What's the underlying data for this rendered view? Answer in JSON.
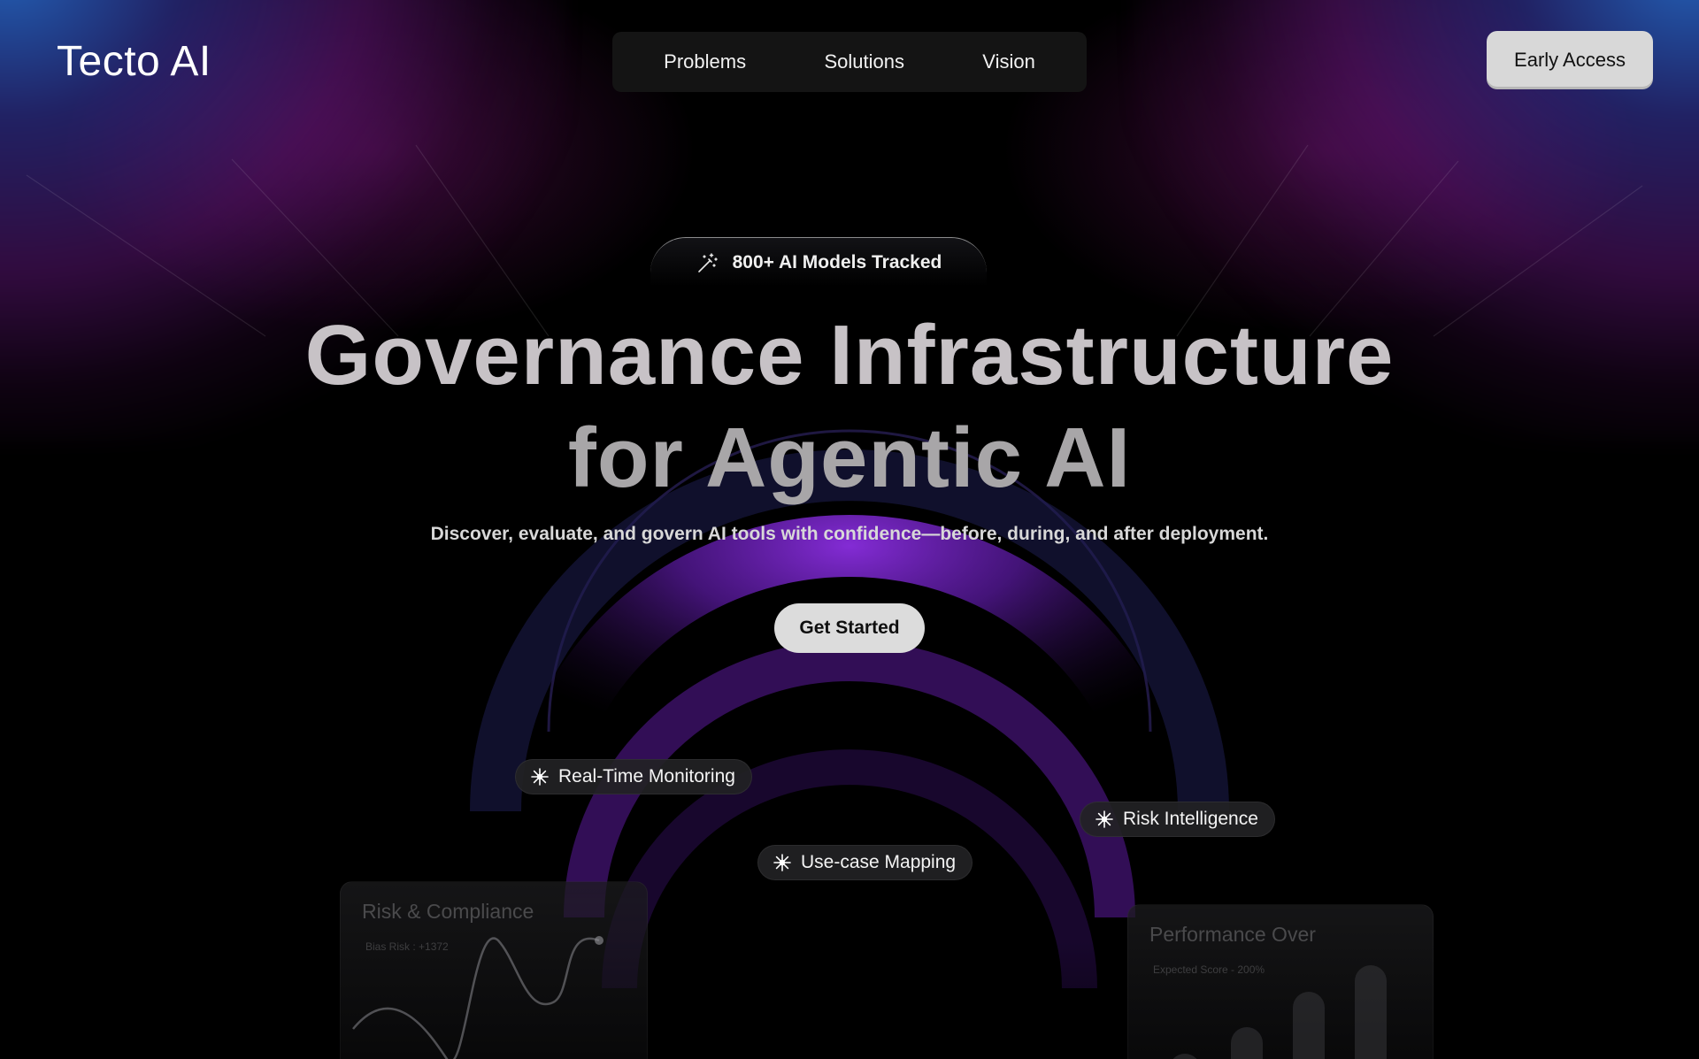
{
  "brand": {
    "logo_text": "Tecto AI"
  },
  "nav": {
    "items": [
      "Problems",
      "Solutions",
      "Vision"
    ]
  },
  "header": {
    "early_access_label": "Early Access"
  },
  "hero": {
    "badge_text": "800+ AI Models Tracked",
    "headline_line1": "Governance Infrastructure",
    "headline_line2": "for Agentic AI",
    "subheadline": "Discover, evaluate, and govern AI tools with confidence—before, during, and after deployment.",
    "cta_label": "Get Started"
  },
  "features": {
    "pills": [
      "Real-Time Monitoring",
      "Risk Intelligence",
      "Use-case Mapping"
    ]
  },
  "cards": {
    "left": {
      "title": "Risk & Compliance",
      "meta": "Bias Risk : +1372"
    },
    "right": {
      "title": "Performance Over",
      "meta": "Expected Score - 200%"
    }
  },
  "icons": {
    "badge_icon": "magic-wand-icon",
    "pill_icon": "sparkle-icon"
  },
  "colors": {
    "background": "#000000",
    "glow_blue": "#2c6ed0",
    "glow_purple": "#6e1a8c",
    "arc_purple": "#7a28c8",
    "cta_bg": "#dcdcdc"
  }
}
